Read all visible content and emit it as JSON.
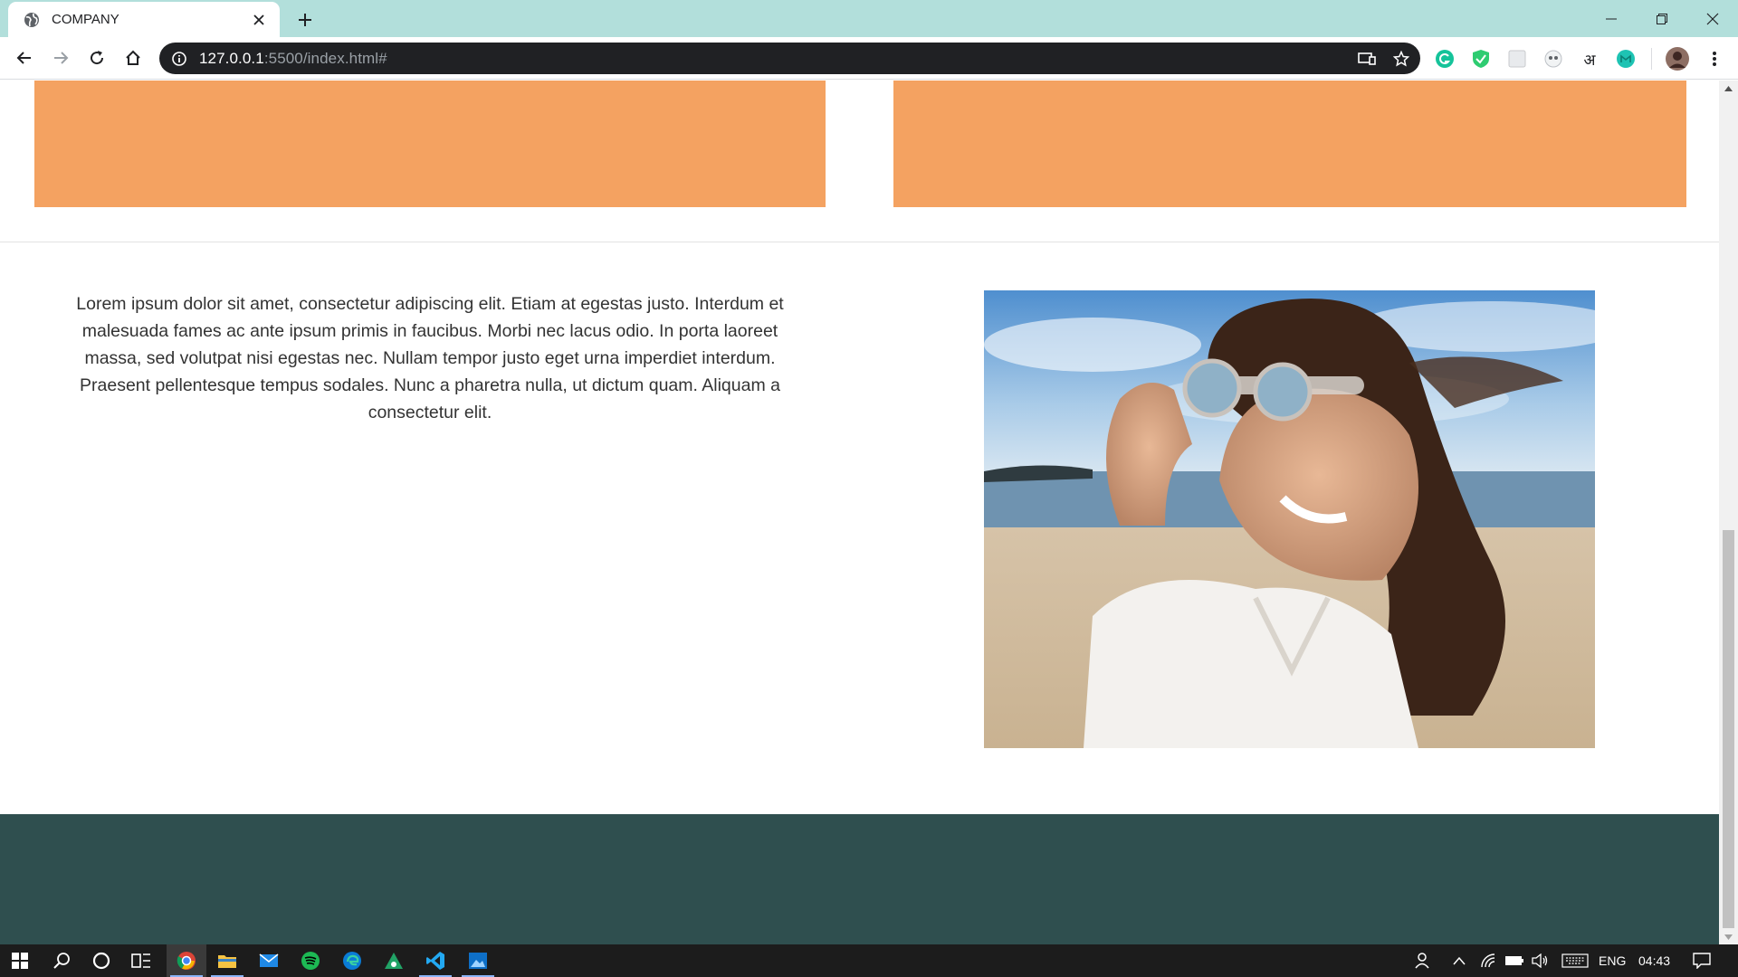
{
  "browser": {
    "tab_title": "COMPANY",
    "url_host": "127.0.0.1",
    "url_rest": ":5500/index.html#"
  },
  "page": {
    "lorem_text": "Lorem ipsum dolor sit amet, consectetur adipiscing elit. Etiam at egestas justo. Interdum et malesuada fames ac ante ipsum primis in faucibus. Morbi nec lacus odio. In porta laoreet massa, sed volutpat nisi egestas nec. Nullam tempor justo eget urna imperdiet interdum. Praesent pellentesque tempus sodales. Nunc a pharetra nulla, ut dictum quam. Aliquam a consectetur elit.",
    "orange_color": "#f4a261",
    "footer_color": "#2f4f4f"
  },
  "taskbar": {
    "language": "ENG",
    "clock": "04:43",
    "ime_glyph": "अ"
  }
}
